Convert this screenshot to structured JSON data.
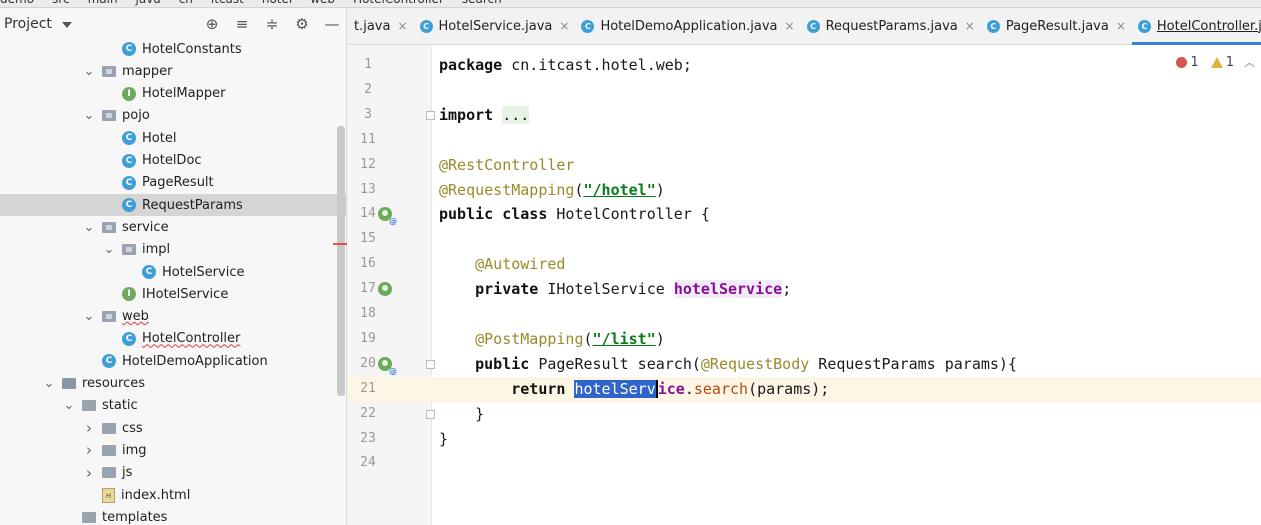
{
  "breadcrumb": [
    "demo",
    "src",
    "main",
    "java",
    "cn",
    "itcast",
    "hotel",
    "web",
    "HotelController",
    "search"
  ],
  "run_config": "HotelDemoApplication",
  "project_panel": {
    "title": "Project",
    "tree": [
      {
        "label": "HotelConstants",
        "icon": "class-icon",
        "depth": 3,
        "expander": "none"
      },
      {
        "label": "mapper",
        "icon": "package-icon",
        "depth": 2,
        "expander": "open"
      },
      {
        "label": "HotelMapper",
        "icon": "interface-icon",
        "depth": 3,
        "expander": "none"
      },
      {
        "label": "pojo",
        "icon": "package-icon",
        "depth": 2,
        "expander": "open"
      },
      {
        "label": "Hotel",
        "icon": "class-icon",
        "depth": 3,
        "expander": "none"
      },
      {
        "label": "HotelDoc",
        "icon": "class-icon",
        "depth": 3,
        "expander": "none"
      },
      {
        "label": "PageResult",
        "icon": "class-icon",
        "depth": 3,
        "expander": "none"
      },
      {
        "label": "RequestParams",
        "icon": "class-icon",
        "depth": 3,
        "expander": "none",
        "selected": true
      },
      {
        "label": "service",
        "icon": "package-icon",
        "depth": 2,
        "expander": "open"
      },
      {
        "label": "impl",
        "icon": "package-icon",
        "depth": 3,
        "expander": "open"
      },
      {
        "label": "HotelService",
        "icon": "class-icon",
        "depth": 4,
        "expander": "none"
      },
      {
        "label": "IHotelService",
        "icon": "interface-icon",
        "depth": 3,
        "expander": "none"
      },
      {
        "label": "web",
        "icon": "package-icon",
        "depth": 2,
        "expander": "open",
        "wavy": true
      },
      {
        "label": "HotelController",
        "icon": "class-icon",
        "depth": 3,
        "expander": "none",
        "wavy": true
      },
      {
        "label": "HotelDemoApplication",
        "icon": "app-icon",
        "depth": 2,
        "expander": "none"
      },
      {
        "label": "resources",
        "icon": "resources-icon",
        "depth": 0,
        "expander": "open"
      },
      {
        "label": "static",
        "icon": "folder-icon",
        "depth": 1,
        "expander": "open"
      },
      {
        "label": "css",
        "icon": "folder-icon",
        "depth": 2,
        "expander": "closed"
      },
      {
        "label": "img",
        "icon": "folder-icon",
        "depth": 2,
        "expander": "closed"
      },
      {
        "label": "js",
        "icon": "folder-icon",
        "depth": 2,
        "expander": "closed"
      },
      {
        "label": "index.html",
        "icon": "html-file-icon",
        "depth": 2,
        "expander": "none"
      },
      {
        "label": "templates",
        "icon": "folder-icon",
        "depth": 1,
        "expander": "none"
      }
    ]
  },
  "tabs": [
    {
      "label": "t.java",
      "closable": true,
      "icon": false
    },
    {
      "label": "HotelService.java",
      "closable": true,
      "icon": true
    },
    {
      "label": "HotelDemoApplication.java",
      "closable": true,
      "icon": true
    },
    {
      "label": "RequestParams.java",
      "closable": true,
      "icon": true
    },
    {
      "label": "PageResult.java",
      "closable": true,
      "icon": true
    },
    {
      "label": "HotelController.java",
      "closable": true,
      "icon": true,
      "active": true
    }
  ],
  "inspections": {
    "errors": "1",
    "warnings": "1"
  },
  "code_lines": [
    {
      "num": "1",
      "html": "<span class=\"kw\">package</span> cn.itcast.hotel.web;"
    },
    {
      "num": "2",
      "html": ""
    },
    {
      "num": "3",
      "html": "<span class=\"kw\">import</span> <span class=\"fold-txt\">...</span>",
      "fold": true
    },
    {
      "num": "11",
      "html": ""
    },
    {
      "num": "12",
      "html": "<span class=\"ann\">@RestController</span>"
    },
    {
      "num": "13",
      "html": "<span class=\"ann\">@RequestMapping</span>(<span class=\"str\">\"/hotel\"</span>)"
    },
    {
      "num": "14",
      "html": "<span class=\"kw\">public class</span> HotelController {",
      "gicon": "bean-at"
    },
    {
      "num": "15",
      "html": ""
    },
    {
      "num": "16",
      "html": "    <span class=\"ann\">@Autowired</span>"
    },
    {
      "num": "17",
      "html": "    <span class=\"kw\">private</span> IHotelService <span class=\"fld\">hotelService</span>;",
      "gicon": "bean"
    },
    {
      "num": "18",
      "html": ""
    },
    {
      "num": "19",
      "html": "    <span class=\"ann\">@PostMapping</span>(<span class=\"str\">\"/list\"</span>)"
    },
    {
      "num": "20",
      "html": "    <span class=\"kw\">public</span> PageResult search(<span class=\"ann\">@RequestBody</span> RequestParams params){",
      "gicon": "bean-at",
      "fold": true
    },
    {
      "num": "21",
      "html": "        <span class=\"kw\">return</span> <span class=\"sel\">hotelServ</span><span class=\"caret\"></span><span class=\"fld-plain\">ice</span>.<span class=\"mcall\">search</span>(params);",
      "current": true
    },
    {
      "num": "22",
      "html": "    }",
      "fold": true
    },
    {
      "num": "23",
      "html": "}"
    },
    {
      "num": "24",
      "html": ""
    }
  ]
}
